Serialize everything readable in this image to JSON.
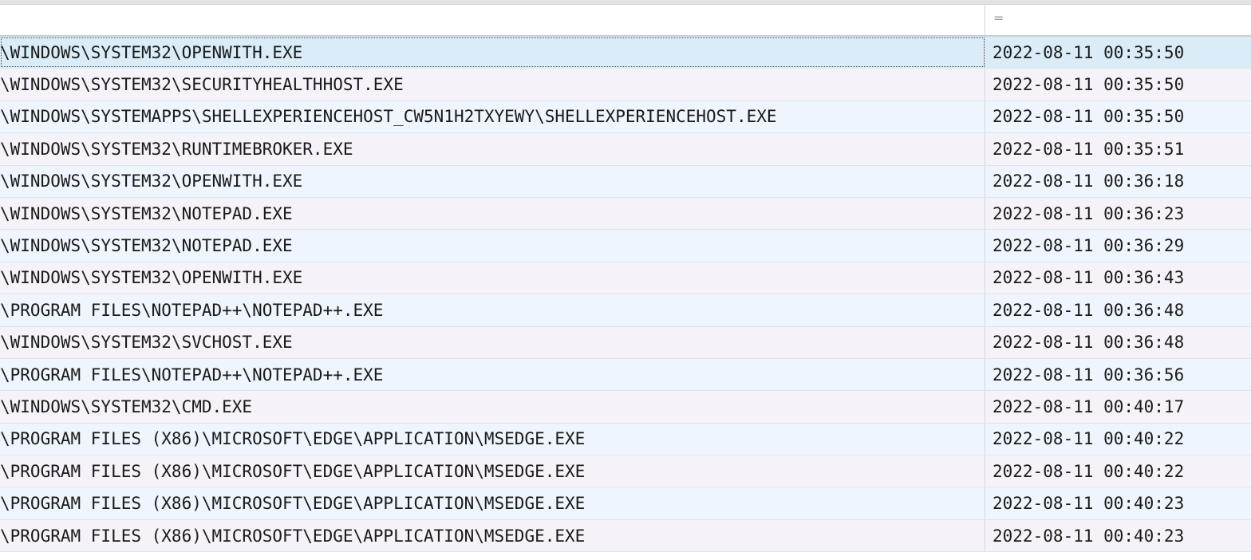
{
  "filter": {
    "operator": "="
  },
  "rows": [
    {
      "path": "\\WINDOWS\\SYSTEM32\\OPENWITH.EXE",
      "time": "2022-08-11 00:35:50"
    },
    {
      "path": "\\WINDOWS\\SYSTEM32\\SECURITYHEALTHHOST.EXE",
      "time": "2022-08-11 00:35:50"
    },
    {
      "path": "\\WINDOWS\\SYSTEMAPPS\\SHELLEXPERIENCEHOST_CW5N1H2TXYEWY\\SHELLEXPERIENCEHOST.EXE",
      "time": "2022-08-11 00:35:50"
    },
    {
      "path": "\\WINDOWS\\SYSTEM32\\RUNTIMEBROKER.EXE",
      "time": "2022-08-11 00:35:51"
    },
    {
      "path": "\\WINDOWS\\SYSTEM32\\OPENWITH.EXE",
      "time": "2022-08-11 00:36:18"
    },
    {
      "path": "\\WINDOWS\\SYSTEM32\\NOTEPAD.EXE",
      "time": "2022-08-11 00:36:23"
    },
    {
      "path": "\\WINDOWS\\SYSTEM32\\NOTEPAD.EXE",
      "time": "2022-08-11 00:36:29"
    },
    {
      "path": "\\WINDOWS\\SYSTEM32\\OPENWITH.EXE",
      "time": "2022-08-11 00:36:43"
    },
    {
      "path": "\\PROGRAM FILES\\NOTEPAD++\\NOTEPAD++.EXE",
      "time": "2022-08-11 00:36:48"
    },
    {
      "path": "\\WINDOWS\\SYSTEM32\\SVCHOST.EXE",
      "time": "2022-08-11 00:36:48"
    },
    {
      "path": "\\PROGRAM FILES\\NOTEPAD++\\NOTEPAD++.EXE",
      "time": "2022-08-11 00:36:56"
    },
    {
      "path": "\\WINDOWS\\SYSTEM32\\CMD.EXE",
      "time": "2022-08-11 00:40:17"
    },
    {
      "path": "\\PROGRAM FILES (X86)\\MICROSOFT\\EDGE\\APPLICATION\\MSEDGE.EXE",
      "time": "2022-08-11 00:40:22"
    },
    {
      "path": "\\PROGRAM FILES (X86)\\MICROSOFT\\EDGE\\APPLICATION\\MSEDGE.EXE",
      "time": "2022-08-11 00:40:22"
    },
    {
      "path": "\\PROGRAM FILES (X86)\\MICROSOFT\\EDGE\\APPLICATION\\MSEDGE.EXE",
      "time": "2022-08-11 00:40:23"
    },
    {
      "path": "\\PROGRAM FILES (X86)\\MICROSOFT\\EDGE\\APPLICATION\\MSEDGE.EXE",
      "time": "2022-08-11 00:40:23"
    }
  ]
}
